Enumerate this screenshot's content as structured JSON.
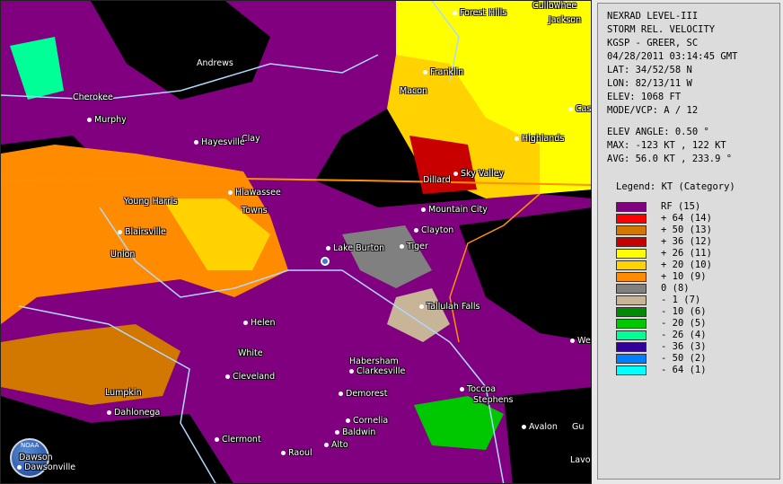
{
  "colors": {
    "rf": "#800080",
    "pos64": "#ff0000",
    "pos50": "#d27800",
    "pos36": "#c80000",
    "pos26": "#ffff00",
    "pos20": "#ffd200",
    "pos10": "#ff8c00",
    "zero": "#808080",
    "neg1": "#c8b496",
    "neg10": "#008c00",
    "neg20": "#00c800",
    "neg26": "#00ff96",
    "neg36": "#320096",
    "neg50": "#0080ff",
    "neg64": "#00ffff"
  },
  "info": {
    "product": "NEXRAD LEVEL-III",
    "type": "STORM REL. VELOCITY",
    "station": "KGSP - GREER, SC",
    "datetime": "04/28/2011 03:14:45 GMT",
    "lat": "LAT: 34/52/58 N",
    "lon": "LON: 82/13/11 W",
    "elev": "ELEV: 1068 FT",
    "mode": "MODE/VCP: A / 12",
    "elev_angle": "ELEV ANGLE: 0.50 °",
    "max": "MAX: -123 KT , 122 KT",
    "avg": "AVG: 56.0 KT , 233.9 °",
    "legend_title": "Legend: KT (Category)"
  },
  "legend": [
    {
      "label": "RF  (15)",
      "color": "#800080"
    },
    {
      "label": "+ 64  (14)",
      "color": "#ff0000"
    },
    {
      "label": "+ 50  (13)",
      "color": "#d27800"
    },
    {
      "label": "+ 36  (12)",
      "color": "#c80000"
    },
    {
      "label": "+ 26  (11)",
      "color": "#ffff00"
    },
    {
      "label": "+ 20  (10)",
      "color": "#ffd200"
    },
    {
      "label": "+ 10  (9)",
      "color": "#ff8c00"
    },
    {
      "label": "0  (8)",
      "color": "#808080"
    },
    {
      "label": "- 1  (7)",
      "color": "#c8b496"
    },
    {
      "label": "- 10  (6)",
      "color": "#008c00"
    },
    {
      "label": "- 20  (5)",
      "color": "#00c800"
    },
    {
      "label": "- 26  (4)",
      "color": "#00ff96"
    },
    {
      "label": "- 36  (3)",
      "color": "#320096"
    },
    {
      "label": "- 50  (2)",
      "color": "#0080ff"
    },
    {
      "label": "- 64  (1)",
      "color": "#00ffff"
    }
  ],
  "places": {
    "forest_hills": "Forest Hills",
    "cullowhee": "Cullowhee",
    "jackson": "Jackson",
    "andrews": "Andrews",
    "franklin": "Franklin",
    "cherokee": "Cherokee",
    "macon": "Macon",
    "murphy": "Murphy",
    "clay": "Clay",
    "hayesville": "Hayesville",
    "cas": "Cas",
    "highlands": "Highlands",
    "sky_valley": "Sky Valley",
    "dillard": "Dillard",
    "young_harris": "Young Harris",
    "hiawassee": "Hiawassee",
    "towns": "Towns",
    "mountain_city": "Mountain City",
    "clayton": "Clayton",
    "blairsville": "Blairsville",
    "union": "Union",
    "lake_burton": "Lake Burton",
    "tiger": "Tiger",
    "tallulah_falls": "Tallulah Falls",
    "helen": "Helen",
    "we": "We",
    "white": "White",
    "habersham": "Habersham",
    "clarkesville": "Clarkesville",
    "cleveland": "Cleveland",
    "lumpkin": "Lumpkin",
    "toccoa": "Toccoa",
    "demorest": "Demorest",
    "stephens": "Stephens",
    "dahlonega": "Dahlonega",
    "cornelia": "Cornelia",
    "avalon": "Avalon",
    "gu": "Gu",
    "baldwin": "Baldwin",
    "clermont": "Clermont",
    "alto": "Alto",
    "raoul": "Raoul",
    "dawson": "Dawson",
    "dawsonville": "Dawsonville",
    "lavo": "Lavo"
  },
  "logo": {
    "text": "NOAA"
  }
}
